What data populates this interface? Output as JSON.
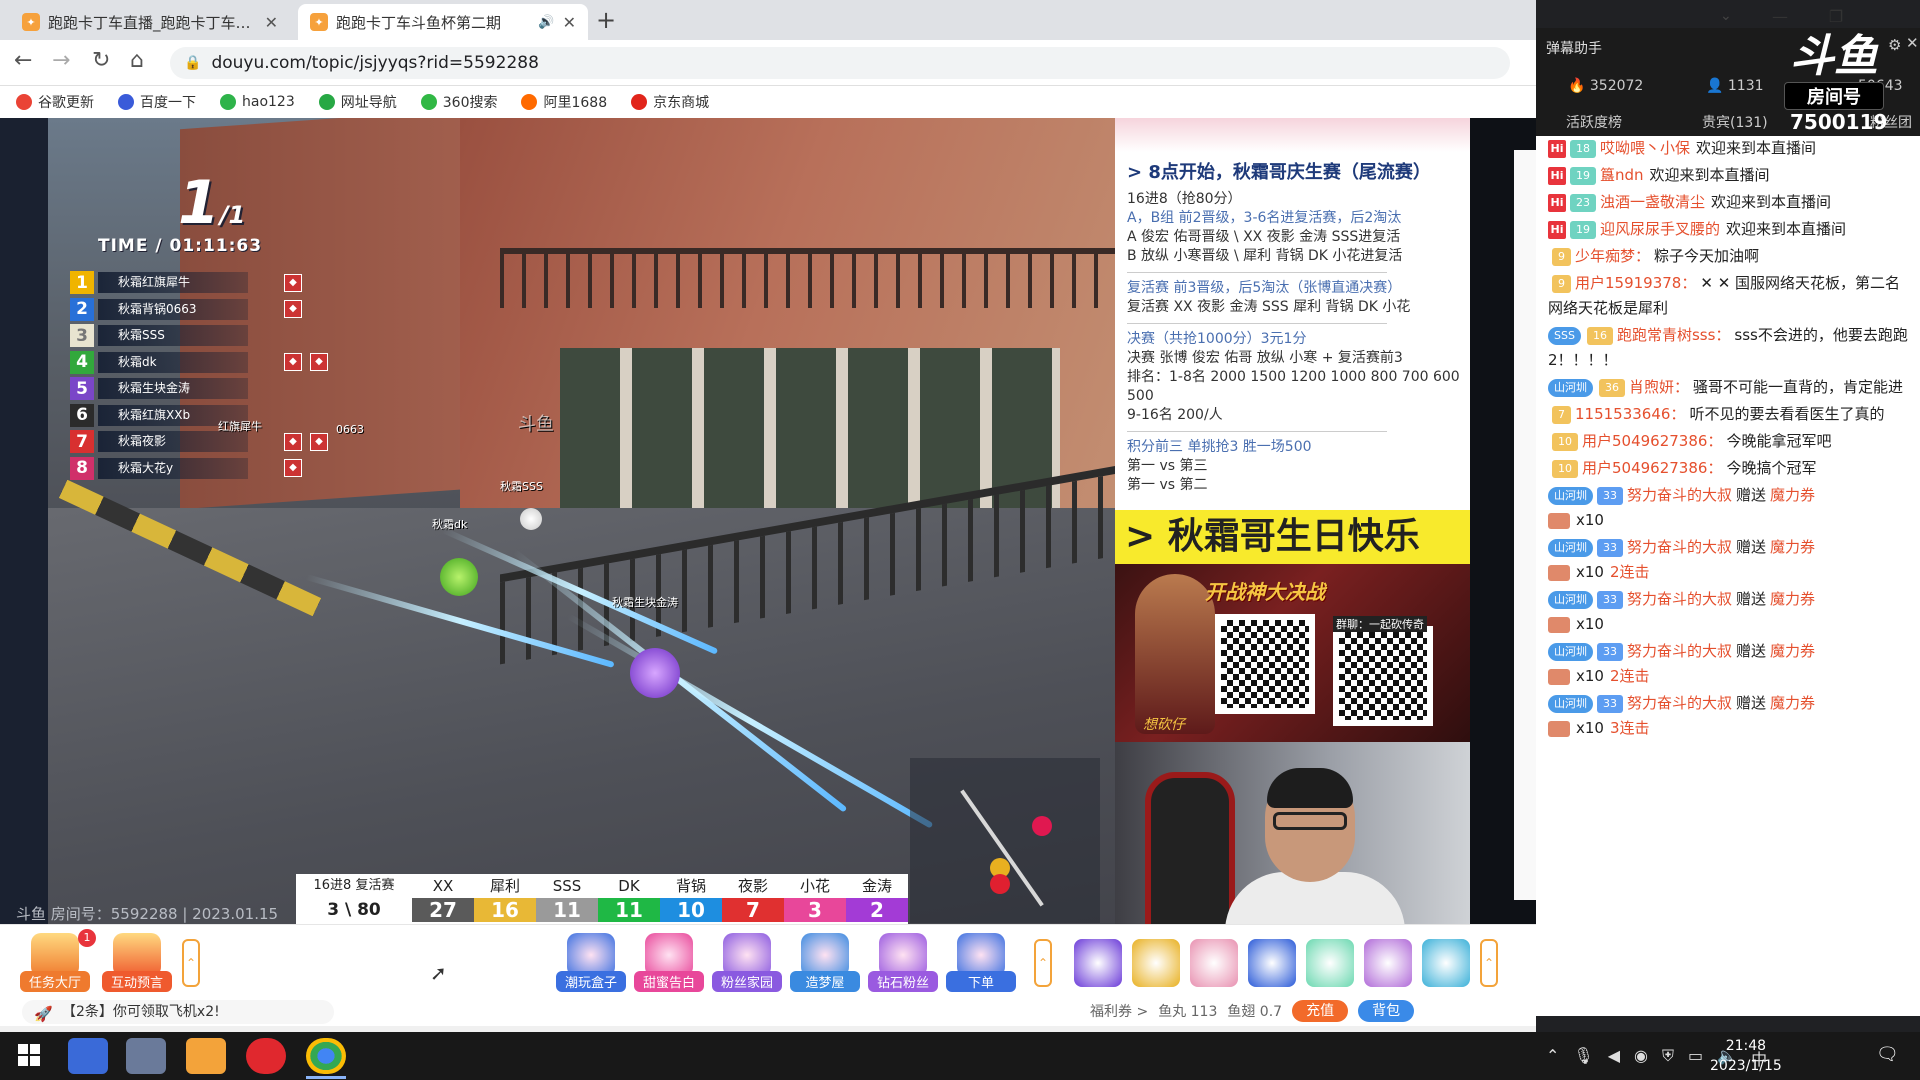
{
  "browser": {
    "tabs": [
      {
        "title": "跑跑卡丁车直播_跑跑卡丁车直播",
        "active": false
      },
      {
        "title": "跑跑卡丁车斗鱼杯第二期",
        "active": true
      }
    ],
    "url": "douyu.com/topic/jsjyyqs?rid=5592288",
    "bookmarks": [
      {
        "label": "谷歌更新",
        "color": "#ea4335"
      },
      {
        "label": "百度一下",
        "color": "#3a5bd9"
      },
      {
        "label": "hao123",
        "color": "#2eb34a"
      },
      {
        "label": "网址导航",
        "color": "#27a844"
      },
      {
        "label": "360搜索",
        "color": "#31b845"
      },
      {
        "label": "阿里1688",
        "color": "#ff6a00"
      },
      {
        "label": "京东商城",
        "color": "#e1251b"
      }
    ]
  },
  "game": {
    "lap_current": "1",
    "lap_total": "/1",
    "time": "TIME / 01:11:63",
    "ranking": [
      {
        "pos": "1",
        "name": "秋霜红旗犀牛",
        "color": "#f0b400"
      },
      {
        "pos": "2",
        "name": "秋霜背锅0663",
        "color": "#2870d8"
      },
      {
        "pos": "3",
        "name": "秋霜SSS",
        "color": "#e8e4d0"
      },
      {
        "pos": "4",
        "name": "秋霜dk",
        "color": "#32a83c"
      },
      {
        "pos": "5",
        "name": "秋霜生块金涛",
        "color": "#7a46c8"
      },
      {
        "pos": "6",
        "name": "秋霜红旗XXb",
        "color": "#2b2b2b"
      },
      {
        "pos": "7",
        "name": "秋霜夜影",
        "color": "#d83030"
      },
      {
        "pos": "8",
        "name": "秋霜大花y",
        "color": "#d0306a"
      }
    ],
    "player_labels": [
      "秋霜SSS",
      "秋霜dk",
      "秋霜生块金涛",
      "红旗犀牛",
      "0663"
    ],
    "watermark": "斗鱼 房间号：5592288 | 2023.01.15",
    "logo_text": "斗鱼"
  },
  "scoreboard": {
    "stage": "16进8 复活赛",
    "progress": "3 \\ 80",
    "players": [
      {
        "name": "XX",
        "score": "27",
        "color": "#5a5a5a"
      },
      {
        "name": "犀利",
        "score": "16",
        "color": "#e8b836"
      },
      {
        "name": "SSS",
        "score": "11",
        "color": "#9a9a9a"
      },
      {
        "name": "DK",
        "score": "11",
        "color": "#1fb845"
      },
      {
        "name": "背锅",
        "score": "10",
        "color": "#1e8ee0"
      },
      {
        "name": "夜影",
        "score": "7",
        "color": "#e03030"
      },
      {
        "name": "小花",
        "score": "3",
        "color": "#e8479a"
      },
      {
        "name": "金涛",
        "score": "2",
        "color": "#a33bd6"
      }
    ]
  },
  "info": {
    "headline": "> 8点开始，秋霜哥庆生赛（尾流赛）",
    "lines": [
      {
        "text": "16进8（抢80分）",
        "style": "normal"
      },
      {
        "text": "A，B组 前2晋级，3-6名进复活赛，后2淘汰",
        "style": "blue"
      },
      {
        "text": "A 俊宏 佑哥晋级 \\ XX 夜影 金涛 SSS进复活",
        "style": "normal"
      },
      {
        "text": "B 放纵 小寒晋级 \\ 犀利 背锅 DK 小花进复活",
        "style": "normal"
      },
      {
        "text": "",
        "style": "hr"
      },
      {
        "text": "复活赛 前3晋级，后5淘汰（张博直通决赛）",
        "style": "blue"
      },
      {
        "text": "复活赛 XX 夜影 金涛 SSS 犀利 背锅 DK 小花",
        "style": "normal"
      },
      {
        "text": "",
        "style": "hr"
      },
      {
        "text": "决赛（共抢1000分）3元1分",
        "style": "blue"
      },
      {
        "text": "决赛 张博 俊宏 佑哥 放纵 小寒 + 复活赛前3",
        "style": "normal"
      },
      {
        "text": "排名：1-8名 2000 1500 1200 1000 800 700 600 500",
        "style": "normal"
      },
      {
        "text": "9-16名 200/人",
        "style": "normal"
      },
      {
        "text": "",
        "style": "hr"
      },
      {
        "text": "积分前三 单挑抢3 胜一场500",
        "style": "blue"
      },
      {
        "text": "第一 vs 第三",
        "style": "normal"
      },
      {
        "text": "第一 vs 第二",
        "style": "normal"
      }
    ],
    "birthday": "> 秋霜哥生日快乐",
    "promo_title": "开战神大决战",
    "promo_qr_label": "群聊：一起砍传奇",
    "promo_sign": "想砍仔"
  },
  "bottombar": {
    "left_items": [
      {
        "label": "任务大厅",
        "color": "#ef7a2e",
        "badge": "1"
      },
      {
        "label": "互动预言",
        "color": "#ef5a2e"
      }
    ],
    "center_items": [
      {
        "label": "潮玩盒子",
        "color": "#3a6fe0"
      },
      {
        "label": "甜蜜告白",
        "color": "#e8479a"
      },
      {
        "label": "粉丝家园",
        "color": "#8a5ae0"
      },
      {
        "label": "造梦屋",
        "color": "#3a8ae0"
      },
      {
        "label": "钻石粉丝",
        "color": "#9a5ae0"
      },
      {
        "label": "下单",
        "color": "#3a6fe0"
      }
    ],
    "right_gift_count": 7,
    "notice": "【2条】你可领取飞机x2!",
    "welfare": "福利券 >",
    "yuwan": "鱼丸 113",
    "yuchi": "鱼翅 0.7",
    "recharge": "充值",
    "backpack": "背包"
  },
  "danmu": {
    "title": "弹幕助手",
    "hot": "352072",
    "fans": "1131",
    "other_stat": "50643",
    "tab_active": "活跃度榜",
    "tab_vip": "贵宾(131)",
    "tab_more": "粉丝团",
    "room_number": "7500119",
    "logo_yu": "斗鱼",
    "logo_room": "房间号",
    "messages": [
      {
        "type": "welcome",
        "level": "18",
        "user": "哎呦喂丶小保",
        "text": "欢迎来到本直播间"
      },
      {
        "type": "welcome",
        "level": "19",
        "user": "簋ndn",
        "text": "欢迎来到本直播间"
      },
      {
        "type": "welcome",
        "level": "23",
        "user": "浊酒一盏敬清尘",
        "text": "欢迎来到本直播间"
      },
      {
        "type": "welcome",
        "level": "19",
        "user": "迎风尿尿手叉腰的",
        "text": "欢迎来到本直播间"
      },
      {
        "type": "chat",
        "level": "9",
        "user": "少年痴梦：",
        "text": "粽子今天加油啊"
      },
      {
        "type": "chat",
        "level": "9",
        "user": "用户15919378：",
        "text": "✕ ✕ 国服网络天花板，第二名网络天花板是犀利"
      },
      {
        "type": "chat",
        "level": "16",
        "fan": "SSS",
        "user": "跑跑常青树sss：",
        "text": "sss不会进的，他要去跑跑2！！！！"
      },
      {
        "type": "chat",
        "level": "36",
        "fan": "山河圳",
        "user": "肖煦妍：",
        "text": "骚哥不可能一直背的，肯定能进"
      },
      {
        "type": "chat",
        "level": "7",
        "user": "1151533646：",
        "text": "听不见的要去看看医生了真的"
      },
      {
        "type": "chat",
        "level": "10",
        "user": "用户5049627386：",
        "text": "今晚能拿冠军吧"
      },
      {
        "type": "chat",
        "level": "10",
        "user": "用户5049627386：",
        "text": "今晚搞个冠军"
      },
      {
        "type": "gift",
        "fan": "山河圳",
        "level": "33",
        "user": "努力奋斗的大叔",
        "verb": "赠送",
        "gift": "魔力券",
        "count": "x10",
        "combo": ""
      },
      {
        "type": "gift",
        "fan": "山河圳",
        "level": "33",
        "user": "努力奋斗的大叔",
        "verb": "赠送",
        "gift": "魔力券",
        "count": "x10",
        "combo": "2连击"
      },
      {
        "type": "gift",
        "fan": "山河圳",
        "level": "33",
        "user": "努力奋斗的大叔",
        "verb": "赠送",
        "gift": "魔力券",
        "count": "x10",
        "combo": ""
      },
      {
        "type": "gift",
        "fan": "山河圳",
        "level": "33",
        "user": "努力奋斗的大叔",
        "verb": "赠送",
        "gift": "魔力券",
        "count": "x10",
        "combo": "2连击"
      },
      {
        "type": "gift",
        "fan": "山河圳",
        "level": "33",
        "user": "努力奋斗的大叔",
        "verb": "赠送",
        "gift": "魔力券",
        "count": "x10",
        "combo": "3连击"
      }
    ]
  },
  "taskbar": {
    "time": "21:48",
    "date": "2023/1/15",
    "ime": "中"
  }
}
